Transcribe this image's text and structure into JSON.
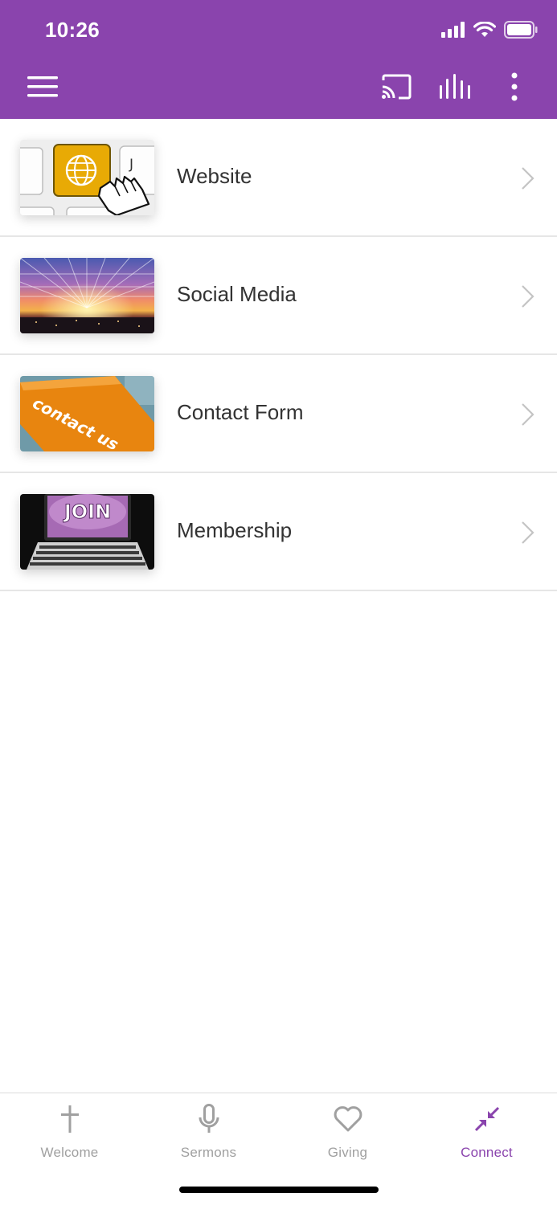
{
  "status_bar": {
    "time": "10:26"
  },
  "colors": {
    "brand": "#8a44ad",
    "tab_inactive": "#a0a0a0",
    "label": "#333333"
  },
  "toolbar": {
    "menu_icon": "hamburger-icon",
    "actions": [
      "cast-icon",
      "audio-bars-icon",
      "more-vertical-icon"
    ]
  },
  "list": {
    "items": [
      {
        "label": "Website",
        "icon": "globe-key-image",
        "thumb_text": "J"
      },
      {
        "label": "Social Media",
        "icon": "sunset-network-image"
      },
      {
        "label": "Contact Form",
        "icon": "contact-us-key-image",
        "thumb_text": "contact us"
      },
      {
        "label": "Membership",
        "icon": "join-laptop-image",
        "thumb_text": "JOIN"
      }
    ]
  },
  "tabs": [
    {
      "label": "Welcome",
      "icon": "cross-icon",
      "active": false
    },
    {
      "label": "Sermons",
      "icon": "microphone-icon",
      "active": false
    },
    {
      "label": "Giving",
      "icon": "heart-icon",
      "active": false
    },
    {
      "label": "Connect",
      "icon": "connect-arrows-icon",
      "active": true
    }
  ]
}
